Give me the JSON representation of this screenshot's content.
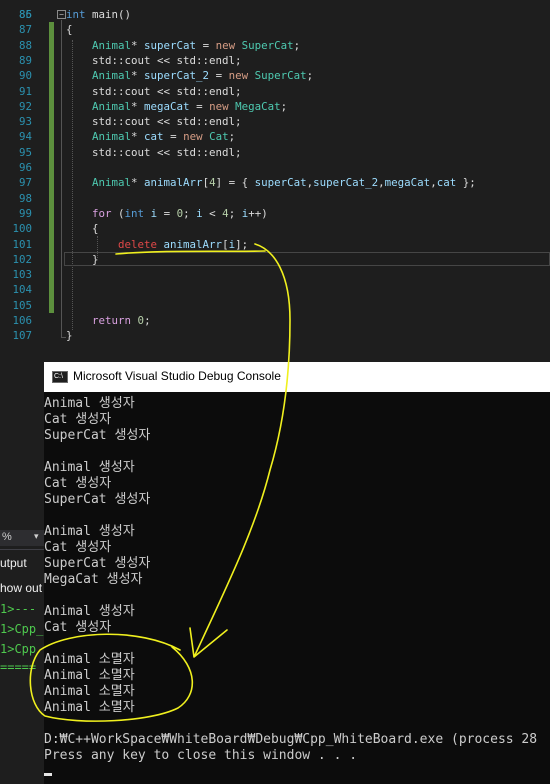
{
  "editor": {
    "first_partial_line": "85",
    "lines": [
      {
        "n": "86",
        "tokens": [
          [
            "kw",
            "int"
          ],
          [
            "cm",
            " main()"
          ]
        ]
      },
      {
        "n": "87",
        "tokens": [
          [
            "cm",
            "{"
          ]
        ]
      },
      {
        "n": "88",
        "tokens": [
          [
            "cm",
            "    "
          ],
          [
            "ty",
            "Animal"
          ],
          [
            "cm",
            "* "
          ],
          [
            "id",
            "superCat"
          ],
          [
            "cm",
            " = "
          ],
          [
            "nw",
            "new"
          ],
          [
            "cm",
            " "
          ],
          [
            "ty",
            "SuperCat"
          ],
          [
            "cm",
            ";"
          ]
        ]
      },
      {
        "n": "89",
        "tokens": [
          [
            "cm",
            "    std::cout << std::endl;"
          ]
        ]
      },
      {
        "n": "90",
        "tokens": [
          [
            "cm",
            "    "
          ],
          [
            "ty",
            "Animal"
          ],
          [
            "cm",
            "* "
          ],
          [
            "id",
            "superCat_2"
          ],
          [
            "cm",
            " = "
          ],
          [
            "nw",
            "new"
          ],
          [
            "cm",
            " "
          ],
          [
            "ty",
            "SuperCat"
          ],
          [
            "cm",
            ";"
          ]
        ]
      },
      {
        "n": "91",
        "tokens": [
          [
            "cm",
            "    std::cout << std::endl;"
          ]
        ]
      },
      {
        "n": "92",
        "tokens": [
          [
            "cm",
            "    "
          ],
          [
            "ty",
            "Animal"
          ],
          [
            "cm",
            "* "
          ],
          [
            "id",
            "megaCat"
          ],
          [
            "cm",
            " = "
          ],
          [
            "nw",
            "new"
          ],
          [
            "cm",
            " "
          ],
          [
            "ty",
            "MegaCat"
          ],
          [
            "cm",
            ";"
          ]
        ]
      },
      {
        "n": "93",
        "tokens": [
          [
            "cm",
            "    std::cout << std::endl;"
          ]
        ]
      },
      {
        "n": "94",
        "tokens": [
          [
            "cm",
            "    "
          ],
          [
            "ty",
            "Animal"
          ],
          [
            "cm",
            "* "
          ],
          [
            "id",
            "cat"
          ],
          [
            "cm",
            " = "
          ],
          [
            "nw",
            "new"
          ],
          [
            "cm",
            " "
          ],
          [
            "ty",
            "Cat"
          ],
          [
            "cm",
            ";"
          ]
        ]
      },
      {
        "n": "95",
        "tokens": [
          [
            "cm",
            "    std::cout << std::endl;"
          ]
        ]
      },
      {
        "n": "96",
        "tokens": []
      },
      {
        "n": "97",
        "tokens": [
          [
            "cm",
            "    "
          ],
          [
            "ty",
            "Animal"
          ],
          [
            "cm",
            "* "
          ],
          [
            "id",
            "animalArr"
          ],
          [
            "cm",
            "["
          ],
          [
            "num",
            "4"
          ],
          [
            "cm",
            "] = { "
          ],
          [
            "id",
            "superCat"
          ],
          [
            "cm",
            ","
          ],
          [
            "id",
            "superCat_2"
          ],
          [
            "cm",
            ","
          ],
          [
            "id",
            "megaCat"
          ],
          [
            "cm",
            ","
          ],
          [
            "id",
            "cat"
          ],
          [
            "cm",
            " };"
          ]
        ]
      },
      {
        "n": "98",
        "tokens": []
      },
      {
        "n": "99",
        "tokens": [
          [
            "cm",
            "    "
          ],
          [
            "kwc",
            "for"
          ],
          [
            "cm",
            " ("
          ],
          [
            "kw",
            "int"
          ],
          [
            "cm",
            " "
          ],
          [
            "id",
            "i"
          ],
          [
            "cm",
            " = "
          ],
          [
            "num",
            "0"
          ],
          [
            "cm",
            "; "
          ],
          [
            "id",
            "i"
          ],
          [
            "cm",
            " < "
          ],
          [
            "num",
            "4"
          ],
          [
            "cm",
            "; "
          ],
          [
            "id",
            "i"
          ],
          [
            "cm",
            "++)"
          ]
        ]
      },
      {
        "n": "100",
        "tokens": [
          [
            "cm",
            "    {"
          ]
        ]
      },
      {
        "n": "101",
        "tokens": [
          [
            "cm",
            "        "
          ],
          [
            "del",
            "delete"
          ],
          [
            "cm",
            " "
          ],
          [
            "id",
            "animalArr"
          ],
          [
            "cm",
            "["
          ],
          [
            "id",
            "i"
          ],
          [
            "cm",
            "];"
          ]
        ]
      },
      {
        "n": "102",
        "tokens": [
          [
            "cm",
            "    }"
          ]
        ]
      },
      {
        "n": "103",
        "tokens": []
      },
      {
        "n": "104",
        "tokens": []
      },
      {
        "n": "105",
        "tokens": []
      },
      {
        "n": "106",
        "tokens": [
          [
            "cm",
            "    "
          ],
          [
            "kwc",
            "return"
          ],
          [
            "cm",
            " "
          ],
          [
            "num",
            "0"
          ],
          [
            "cm",
            ";"
          ]
        ]
      },
      {
        "n": "107",
        "tokens": [
          [
            "cm",
            "}"
          ]
        ]
      }
    ]
  },
  "left_panel": {
    "zoom_value": "%",
    "zoom_arrow": "▾",
    "output_label": "utput",
    "show_output_label": "how out",
    "build_lines": [
      "1>---",
      "1>Cpp_",
      "1>Cpp",
      "====="
    ]
  },
  "console": {
    "title": "Microsoft Visual Studio Debug Console",
    "icon_text": "C:\\",
    "lines": [
      "Animal 생성자",
      "Cat 생성자",
      "SuperCat 생성자",
      "",
      "Animal 생성자",
      "Cat 생성자",
      "SuperCat 생성자",
      "",
      "Animal 생성자",
      "Cat 생성자",
      "SuperCat 생성자",
      "MegaCat 생성자",
      "",
      "Animal 생성자",
      "Cat 생성자",
      "",
      "Animal 소멸자",
      "Animal 소멸자",
      "Animal 소멸자",
      "Animal 소멸자",
      "",
      "D:₩C++WorkSpace₩WhiteBoard₩Debug₩Cpp_WhiteBoard.exe (process 28",
      "Press any key to close this window . . ."
    ]
  },
  "colors": {
    "editor_bg": "#1e1e1e",
    "keyword": "#569cd6",
    "type": "#4ec9b0",
    "identifier": "#9cdcfe",
    "annotation": "#f0f01e"
  }
}
